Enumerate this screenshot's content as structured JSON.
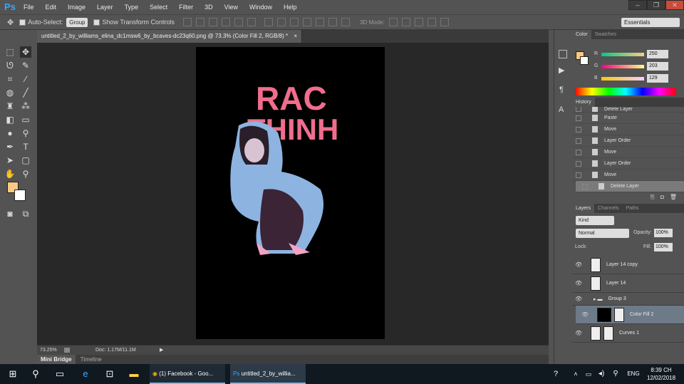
{
  "app": {
    "logo": "Ps"
  },
  "menu": [
    "File",
    "Edit",
    "Image",
    "Layer",
    "Type",
    "Select",
    "Filter",
    "3D",
    "View",
    "Window",
    "Help"
  ],
  "options_bar": {
    "auto_select_label": "Auto-Select:",
    "auto_select_value": "Group",
    "transform_label": "Show Transform Controls",
    "mode_3d_label": "3D Mode:",
    "workspace": "Essentials"
  },
  "document": {
    "tab_title": "untitled_2_by_williams_elina_dc1msw6_by_bcaves-dc23q60.png @ 73.3% (Color Fill 2, RGB/8) *",
    "close": "×",
    "artwork_line1": "RAC",
    "artwork_line2": "THINH",
    "artwork_color": "#f06d8d"
  },
  "status": {
    "zoom": "73.25%",
    "doc_info": "Doc: 1.17M/11.1M"
  },
  "bottom_tabs": [
    "Mini Bridge",
    "Timeline"
  ],
  "color_panel": {
    "tabs": [
      "Color",
      "Swatches"
    ],
    "r_label": "R",
    "g_label": "G",
    "b_label": "B",
    "r": "250",
    "g": "203",
    "b": "129",
    "fg": "#fbc982",
    "bg": "#ffffff"
  },
  "history_panel": {
    "tab": "History",
    "items": [
      "Delete Layer",
      "Paste",
      "Move",
      "Layer Order",
      "Move",
      "Layer Order",
      "Move",
      "Delete Layer"
    ]
  },
  "layers_panel": {
    "tabs": [
      "Layers",
      "Channels",
      "Paths"
    ],
    "kind": "Kind",
    "blend_mode": "Normal",
    "opacity_label": "Opacity:",
    "opacity": "100%",
    "lock_label": "Lock:",
    "fill_label": "Fill:",
    "fill": "100%",
    "layers": [
      "Layer 14 copy",
      "Layer 14",
      "Group 3",
      "Color Fill 2",
      "Curves 1"
    ]
  },
  "taskbar": {
    "facebook": "(1) Facebook - Goo...",
    "photoshop": "untitled_2_by_willia...",
    "time": "8:39 CH",
    "date": "12/02/2018",
    "lang": "ENG"
  }
}
